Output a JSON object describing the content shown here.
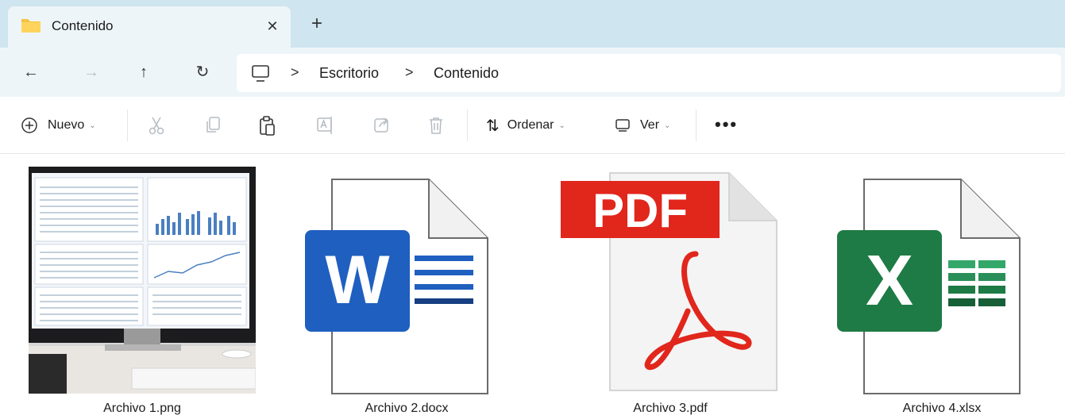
{
  "tab": {
    "title": "Contenido",
    "close": "✕",
    "new": "+"
  },
  "nav": {
    "back": "←",
    "forward": "→",
    "up": "↑",
    "refresh": "↻"
  },
  "breadcrumb": {
    "items": [
      "Escritorio",
      "Contenido"
    ],
    "separator": ">"
  },
  "toolbar": {
    "new_label": "Nuevo",
    "sort_label": "Ordenar",
    "view_label": "Ver",
    "more": "•••",
    "chevron": "⌄"
  },
  "files": [
    {
      "name": "Archivo 1.png",
      "icon": "image-thumbnail"
    },
    {
      "name": "Archivo 2.docx",
      "icon": "word-document-icon",
      "badge": "W"
    },
    {
      "name": "Archivo 3.pdf",
      "icon": "pdf-document-icon",
      "badge": "PDF"
    },
    {
      "name": "Archivo 4.xlsx",
      "icon": "excel-document-icon",
      "badge": "X"
    }
  ],
  "colors": {
    "tabstrip": "#cfe5ef",
    "word": "#1f5fbf",
    "pdf": "#e1261c",
    "excel": "#1e7b45"
  }
}
